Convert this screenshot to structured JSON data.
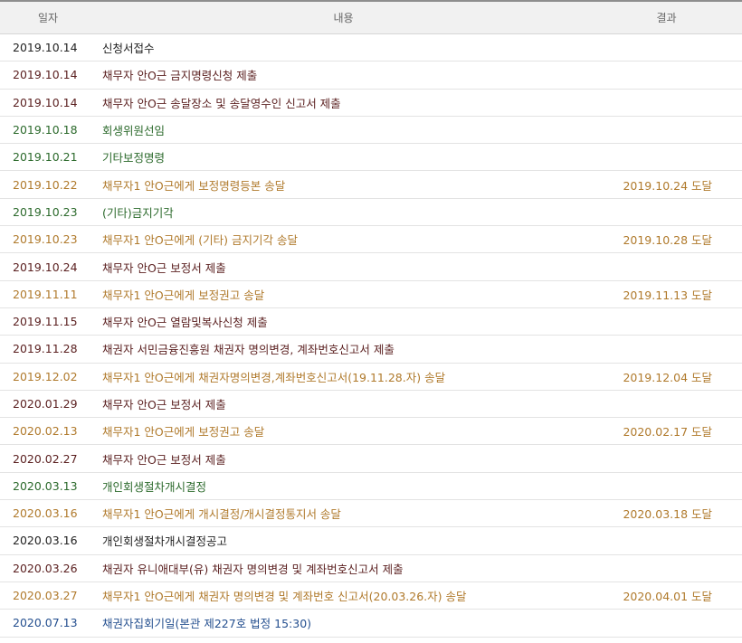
{
  "table": {
    "headers": {
      "date": "일자",
      "content": "내용",
      "result": "결과"
    },
    "colors": {
      "black": "#222222",
      "maroon": "#5a1f1f",
      "green": "#2c6a2c",
      "gold": "#b07a2c",
      "blue": "#244f8f"
    },
    "rows": [
      {
        "date": "2019.10.14",
        "content": "신청서접수",
        "result": "",
        "color": "black"
      },
      {
        "date": "2019.10.14",
        "content": "채무자 안O근 금지명령신청 제출",
        "result": "",
        "color": "maroon"
      },
      {
        "date": "2019.10.14",
        "content": "채무자 안O근 송달장소 및 송달영수인 신고서 제출",
        "result": "",
        "color": "maroon"
      },
      {
        "date": "2019.10.18",
        "content": "회생위원선임",
        "result": "",
        "color": "green"
      },
      {
        "date": "2019.10.21",
        "content": "기타보정명령",
        "result": "",
        "color": "green"
      },
      {
        "date": "2019.10.22",
        "content": "채무자1 안O근에게 보정명령등본 송달",
        "result": "2019.10.24 도달",
        "color": "gold"
      },
      {
        "date": "2019.10.23",
        "content": "(기타)금지기각",
        "result": "",
        "color": "green"
      },
      {
        "date": "2019.10.23",
        "content": "채무자1 안O근에게 (기타) 금지기각 송달",
        "result": "2019.10.28 도달",
        "color": "gold"
      },
      {
        "date": "2019.10.24",
        "content": "채무자 안O근 보정서 제출",
        "result": "",
        "color": "maroon"
      },
      {
        "date": "2019.11.11",
        "content": "채무자1 안O근에게 보정권고 송달",
        "result": "2019.11.13 도달",
        "color": "gold"
      },
      {
        "date": "2019.11.15",
        "content": "채무자 안O근 열람및복사신청 제출",
        "result": "",
        "color": "maroon"
      },
      {
        "date": "2019.11.28",
        "content": "채권자 서민금융진흥원 채권자 명의변경, 계좌번호신고서 제출",
        "result": "",
        "color": "maroon"
      },
      {
        "date": "2019.12.02",
        "content": "채무자1 안O근에게 채권자명의변경,계좌번호신고서(19.11.28.자) 송달",
        "result": "2019.12.04 도달",
        "color": "gold"
      },
      {
        "date": "2020.01.29",
        "content": "채무자 안O근 보정서 제출",
        "result": "",
        "color": "maroon"
      },
      {
        "date": "2020.02.13",
        "content": "채무자1 안O근에게 보정권고 송달",
        "result": "2020.02.17 도달",
        "color": "gold"
      },
      {
        "date": "2020.02.27",
        "content": "채무자 안O근 보정서 제출",
        "result": "",
        "color": "maroon"
      },
      {
        "date": "2020.03.13",
        "content": "개인회생절차개시결정",
        "result": "",
        "color": "green"
      },
      {
        "date": "2020.03.16",
        "content": "채무자1 안O근에게 개시결정/개시결정통지서 송달",
        "result": "2020.03.18 도달",
        "color": "gold"
      },
      {
        "date": "2020.03.16",
        "content": "개인회생절차개시결정공고",
        "result": "",
        "color": "black"
      },
      {
        "date": "2020.03.26",
        "content": "채권자 유니애대부(유) 채권자 명의변경 및 계좌번호신고서 제출",
        "result": "",
        "color": "maroon"
      },
      {
        "date": "2020.03.27",
        "content": "채무자1 안O근에게 채권자 명의변경 및 계좌번호 신고서(20.03.26.자) 송달",
        "result": "2020.04.01 도달",
        "color": "gold"
      },
      {
        "date": "2020.07.13",
        "content": "채권자집회기일(본관 제227호 법정 15:30)",
        "result": "",
        "color": "blue"
      }
    ]
  }
}
